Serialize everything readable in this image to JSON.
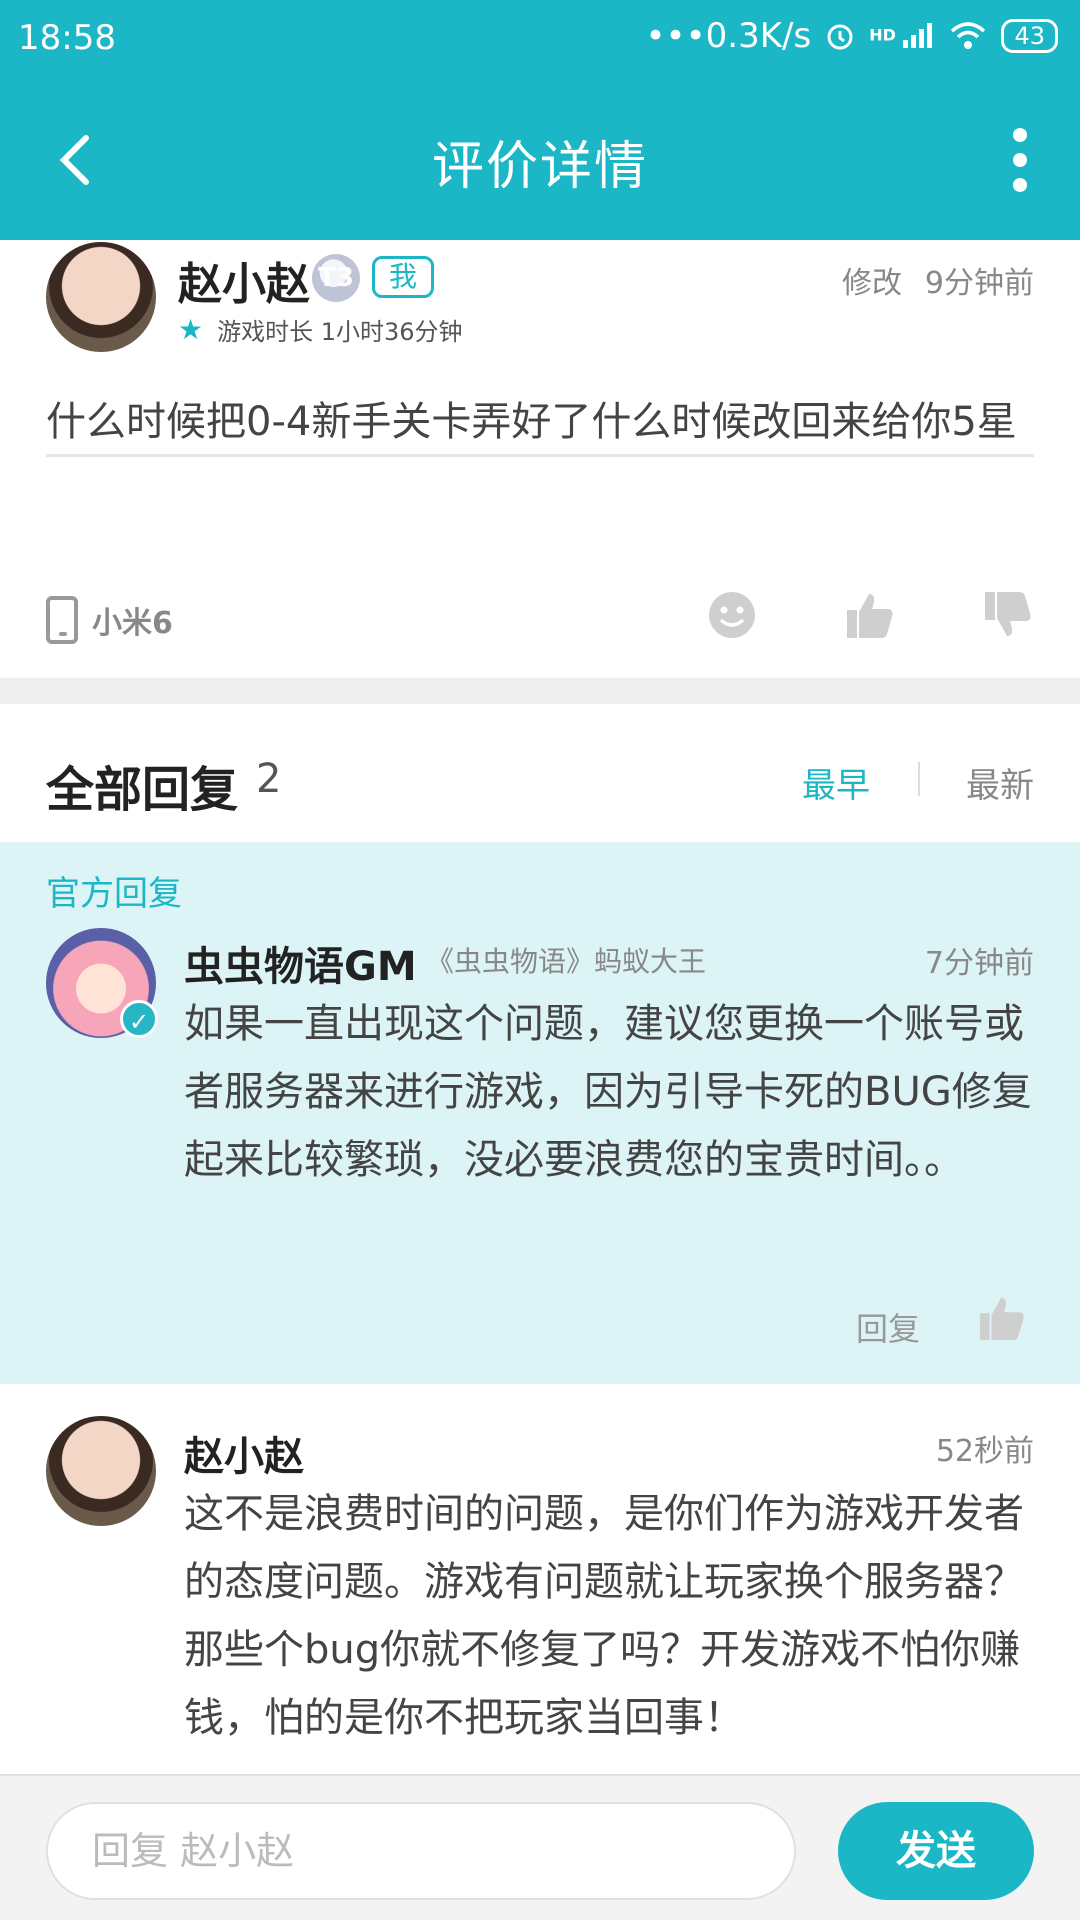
{
  "status": {
    "time": "18:58",
    "net": "•••0.3K/s",
    "signal": "HD",
    "battery": "43"
  },
  "header": {
    "title": "评价详情"
  },
  "review": {
    "user_name": "赵小赵",
    "level": "T3",
    "me_tag": "我",
    "edit_label": "修改",
    "time": "9分钟前",
    "playtime": "游戏时长 1小时36分钟",
    "content": "什么时候把0-4新手关卡弄好了什么时候改回来给你5星",
    "device": "小米6"
  },
  "replies": {
    "label": "全部回复",
    "count": "2",
    "sort_early": "最早",
    "sort_new": "最新"
  },
  "official_reply": {
    "tag": "官方回复",
    "name": "虫虫物语GM",
    "subtitle": "《虫虫物语》蚂蚁大王",
    "time": "7分钟前",
    "content": "如果一直出现这个问题，建议您更换一个账号或者服务器来进行游戏，因为引导卡死的BUG修复起来比较繁琐，没必要浪费您的宝贵时间。。",
    "reply_label": "回复"
  },
  "user_reply": {
    "name": "赵小赵",
    "time": "52秒前",
    "content": "这不是浪费时间的问题，是你们作为游戏开发者的态度问题。游戏有问题就让玩家换个服务器？那些个bug你就不修复了吗？开发游戏不怕你赚钱，怕的是你不把玩家当回事！"
  },
  "composer": {
    "placeholder": "回复 赵小赵",
    "send_label": "发送"
  },
  "colors": {
    "accent": "#1cb7c6",
    "official_bg": "#dcf4f6"
  }
}
